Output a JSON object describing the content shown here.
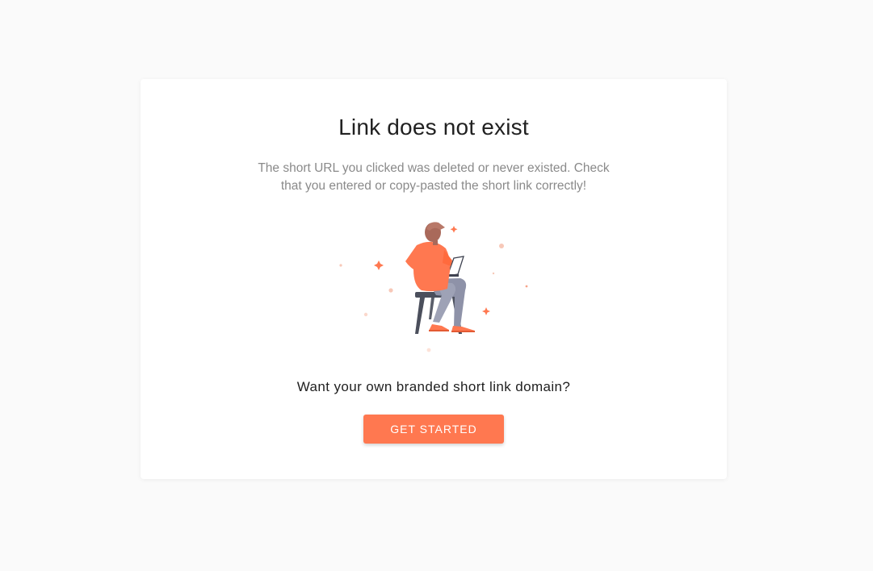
{
  "error_card": {
    "title": "Link does not exist",
    "description": "The short URL you clicked was deleted or never existed. Check that you entered or copy-pasted the short link correctly!",
    "illustration": "person-with-laptop-on-chair-illustration",
    "question": "Want your own branded short link domain?",
    "cta_label": "GET STARTED"
  },
  "colors": {
    "background": "#fafafa",
    "card": "#ffffff",
    "accent": "#ff7850",
    "title_text": "#212121",
    "muted_text": "#8a8a8a"
  }
}
